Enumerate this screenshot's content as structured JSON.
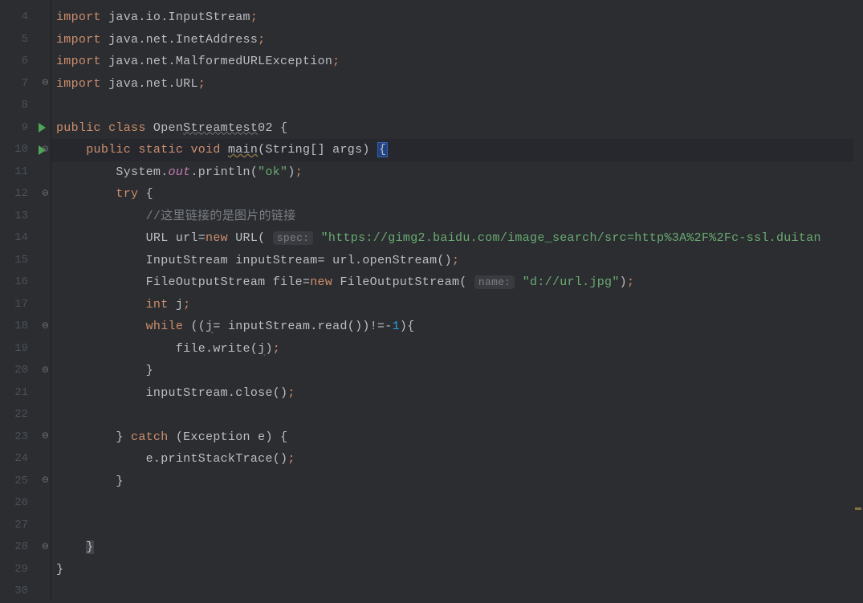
{
  "lines": [
    {
      "num": "4",
      "tokens": [
        {
          "t": "import ",
          "c": "kw"
        },
        {
          "t": "java.io.InputStream",
          "c": "def"
        },
        {
          "t": ";",
          "c": "kw"
        }
      ]
    },
    {
      "num": "5",
      "tokens": [
        {
          "t": "import ",
          "c": "kw"
        },
        {
          "t": "java.net.InetAddress",
          "c": "def"
        },
        {
          "t": ";",
          "c": "kw"
        }
      ]
    },
    {
      "num": "6",
      "tokens": [
        {
          "t": "import ",
          "c": "kw"
        },
        {
          "t": "java.net.MalformedURLException",
          "c": "def"
        },
        {
          "t": ";",
          "c": "kw"
        }
      ]
    },
    {
      "num": "7",
      "fold": "up",
      "tokens": [
        {
          "t": "import ",
          "c": "kw"
        },
        {
          "t": "java.net.URL",
          "c": "def"
        },
        {
          "t": ";",
          "c": "kw"
        }
      ]
    },
    {
      "num": "8",
      "tokens": []
    },
    {
      "num": "9",
      "run": true,
      "tokens": [
        {
          "t": "public class ",
          "c": "kw"
        },
        {
          "t": "Open",
          "c": "def"
        },
        {
          "t": "Streamtest",
          "c": "def wavy"
        },
        {
          "t": "02 {",
          "c": "def"
        }
      ]
    },
    {
      "num": "10",
      "run": true,
      "fold": "down",
      "highlight": true,
      "tokens": [
        {
          "t": "    ",
          "c": ""
        },
        {
          "t": "public static void ",
          "c": "kw"
        },
        {
          "t": "main",
          "c": "warn-u"
        },
        {
          "t": "(String[] args) ",
          "c": "def"
        },
        {
          "t": "{",
          "c": "caret-box"
        }
      ]
    },
    {
      "num": "11",
      "tokens": [
        {
          "t": "        System.",
          "c": "def"
        },
        {
          "t": "out",
          "c": "field-italic"
        },
        {
          "t": ".println(",
          "c": "def"
        },
        {
          "t": "\"ok\"",
          "c": "str"
        },
        {
          "t": ")",
          "c": "def"
        },
        {
          "t": ";",
          "c": "kw"
        }
      ]
    },
    {
      "num": "12",
      "fold": "down",
      "tokens": [
        {
          "t": "        ",
          "c": ""
        },
        {
          "t": "try ",
          "c": "kw"
        },
        {
          "t": "{",
          "c": "def"
        }
      ]
    },
    {
      "num": "13",
      "tokens": [
        {
          "t": "            ",
          "c": ""
        },
        {
          "t": "//这里链接的是图片的链接",
          "c": "comment"
        }
      ]
    },
    {
      "num": "14",
      "tokens": [
        {
          "t": "            URL url=",
          "c": "def"
        },
        {
          "t": "new ",
          "c": "kw"
        },
        {
          "t": "URL( ",
          "c": "def"
        },
        {
          "t": "spec:",
          "c": "hint"
        },
        {
          "t": " ",
          "c": ""
        },
        {
          "t": "\"https://gimg2.baidu.com/image_search/src=http%3A%2F%2Fc-ssl.duitan",
          "c": "str"
        }
      ]
    },
    {
      "num": "15",
      "tokens": [
        {
          "t": "            InputStream inputStream= url.openStream()",
          "c": "def"
        },
        {
          "t": ";",
          "c": "kw"
        }
      ]
    },
    {
      "num": "16",
      "tokens": [
        {
          "t": "            FileOutputStream file=",
          "c": "def"
        },
        {
          "t": "new ",
          "c": "kw"
        },
        {
          "t": "FileOutputStream( ",
          "c": "def"
        },
        {
          "t": "name:",
          "c": "hint"
        },
        {
          "t": " ",
          "c": ""
        },
        {
          "t": "\"d://url.jpg\"",
          "c": "str"
        },
        {
          "t": ")",
          "c": "def"
        },
        {
          "t": ";",
          "c": "kw"
        }
      ]
    },
    {
      "num": "17",
      "tokens": [
        {
          "t": "            ",
          "c": ""
        },
        {
          "t": "int ",
          "c": "kw"
        },
        {
          "t": "j",
          "c": "def"
        },
        {
          "t": ";",
          "c": "kw"
        }
      ]
    },
    {
      "num": "18",
      "fold": "down",
      "tokens": [
        {
          "t": "            ",
          "c": ""
        },
        {
          "t": "while ",
          "c": "kw"
        },
        {
          "t": "((",
          "c": "def"
        },
        {
          "t": "j",
          "c": "def wavy"
        },
        {
          "t": "= inputStream.read())!=-",
          "c": "def"
        },
        {
          "t": "1",
          "c": "num"
        },
        {
          "t": "){",
          "c": "def"
        }
      ]
    },
    {
      "num": "19",
      "tokens": [
        {
          "t": "                file.write(",
          "c": "def"
        },
        {
          "t": "j",
          "c": "def wavy"
        },
        {
          "t": ")",
          "c": "def"
        },
        {
          "t": ";",
          "c": "kw"
        }
      ]
    },
    {
      "num": "20",
      "fold": "up",
      "tokens": [
        {
          "t": "            }",
          "c": "def"
        }
      ]
    },
    {
      "num": "21",
      "tokens": [
        {
          "t": "            inputStream.close()",
          "c": "def"
        },
        {
          "t": ";",
          "c": "kw"
        }
      ]
    },
    {
      "num": "22",
      "tokens": []
    },
    {
      "num": "23",
      "fold": "down",
      "tokens": [
        {
          "t": "        } ",
          "c": "def"
        },
        {
          "t": "catch ",
          "c": "kw"
        },
        {
          "t": "(Exception e) {",
          "c": "def"
        }
      ]
    },
    {
      "num": "24",
      "tokens": [
        {
          "t": "            e.printStackTrace()",
          "c": "def"
        },
        {
          "t": ";",
          "c": "kw"
        }
      ]
    },
    {
      "num": "25",
      "fold": "up",
      "tokens": [
        {
          "t": "        }",
          "c": "def"
        }
      ]
    },
    {
      "num": "26",
      "tokens": []
    },
    {
      "num": "27",
      "tokens": []
    },
    {
      "num": "28",
      "fold": "up",
      "tokens": [
        {
          "t": "    ",
          "c": ""
        },
        {
          "t": "}",
          "c": "close-hl"
        }
      ]
    },
    {
      "num": "29",
      "tokens": [
        {
          "t": "}",
          "c": "def"
        }
      ]
    },
    {
      "num": "30",
      "tokens": []
    }
  ]
}
